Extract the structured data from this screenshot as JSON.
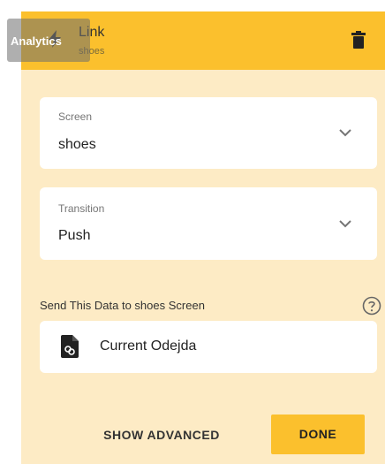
{
  "header": {
    "title": "Link",
    "subtitle": "shoes",
    "icon": "lightning-bolt-icon",
    "delete_icon": "trash-icon",
    "background": "#fbc02d"
  },
  "overlay": {
    "analytics_label": "Analytics"
  },
  "screen_field": {
    "label": "Screen",
    "value": "shoes",
    "icon": "chevron-down-icon"
  },
  "transition_field": {
    "label": "Transition",
    "value": "Push",
    "icon": "chevron-down-icon"
  },
  "data_section": {
    "label": "Send This Data to shoes Screen",
    "help_icon": "help-circle-icon",
    "item_icon": "linked-file-icon",
    "item_value": "Current Odejda"
  },
  "actions": {
    "advanced_label": "SHOW ADVANCED",
    "done_label": "DONE"
  },
  "colors": {
    "accent": "#fbc02d",
    "panel": "#fdebc5",
    "card": "#ffffff"
  }
}
